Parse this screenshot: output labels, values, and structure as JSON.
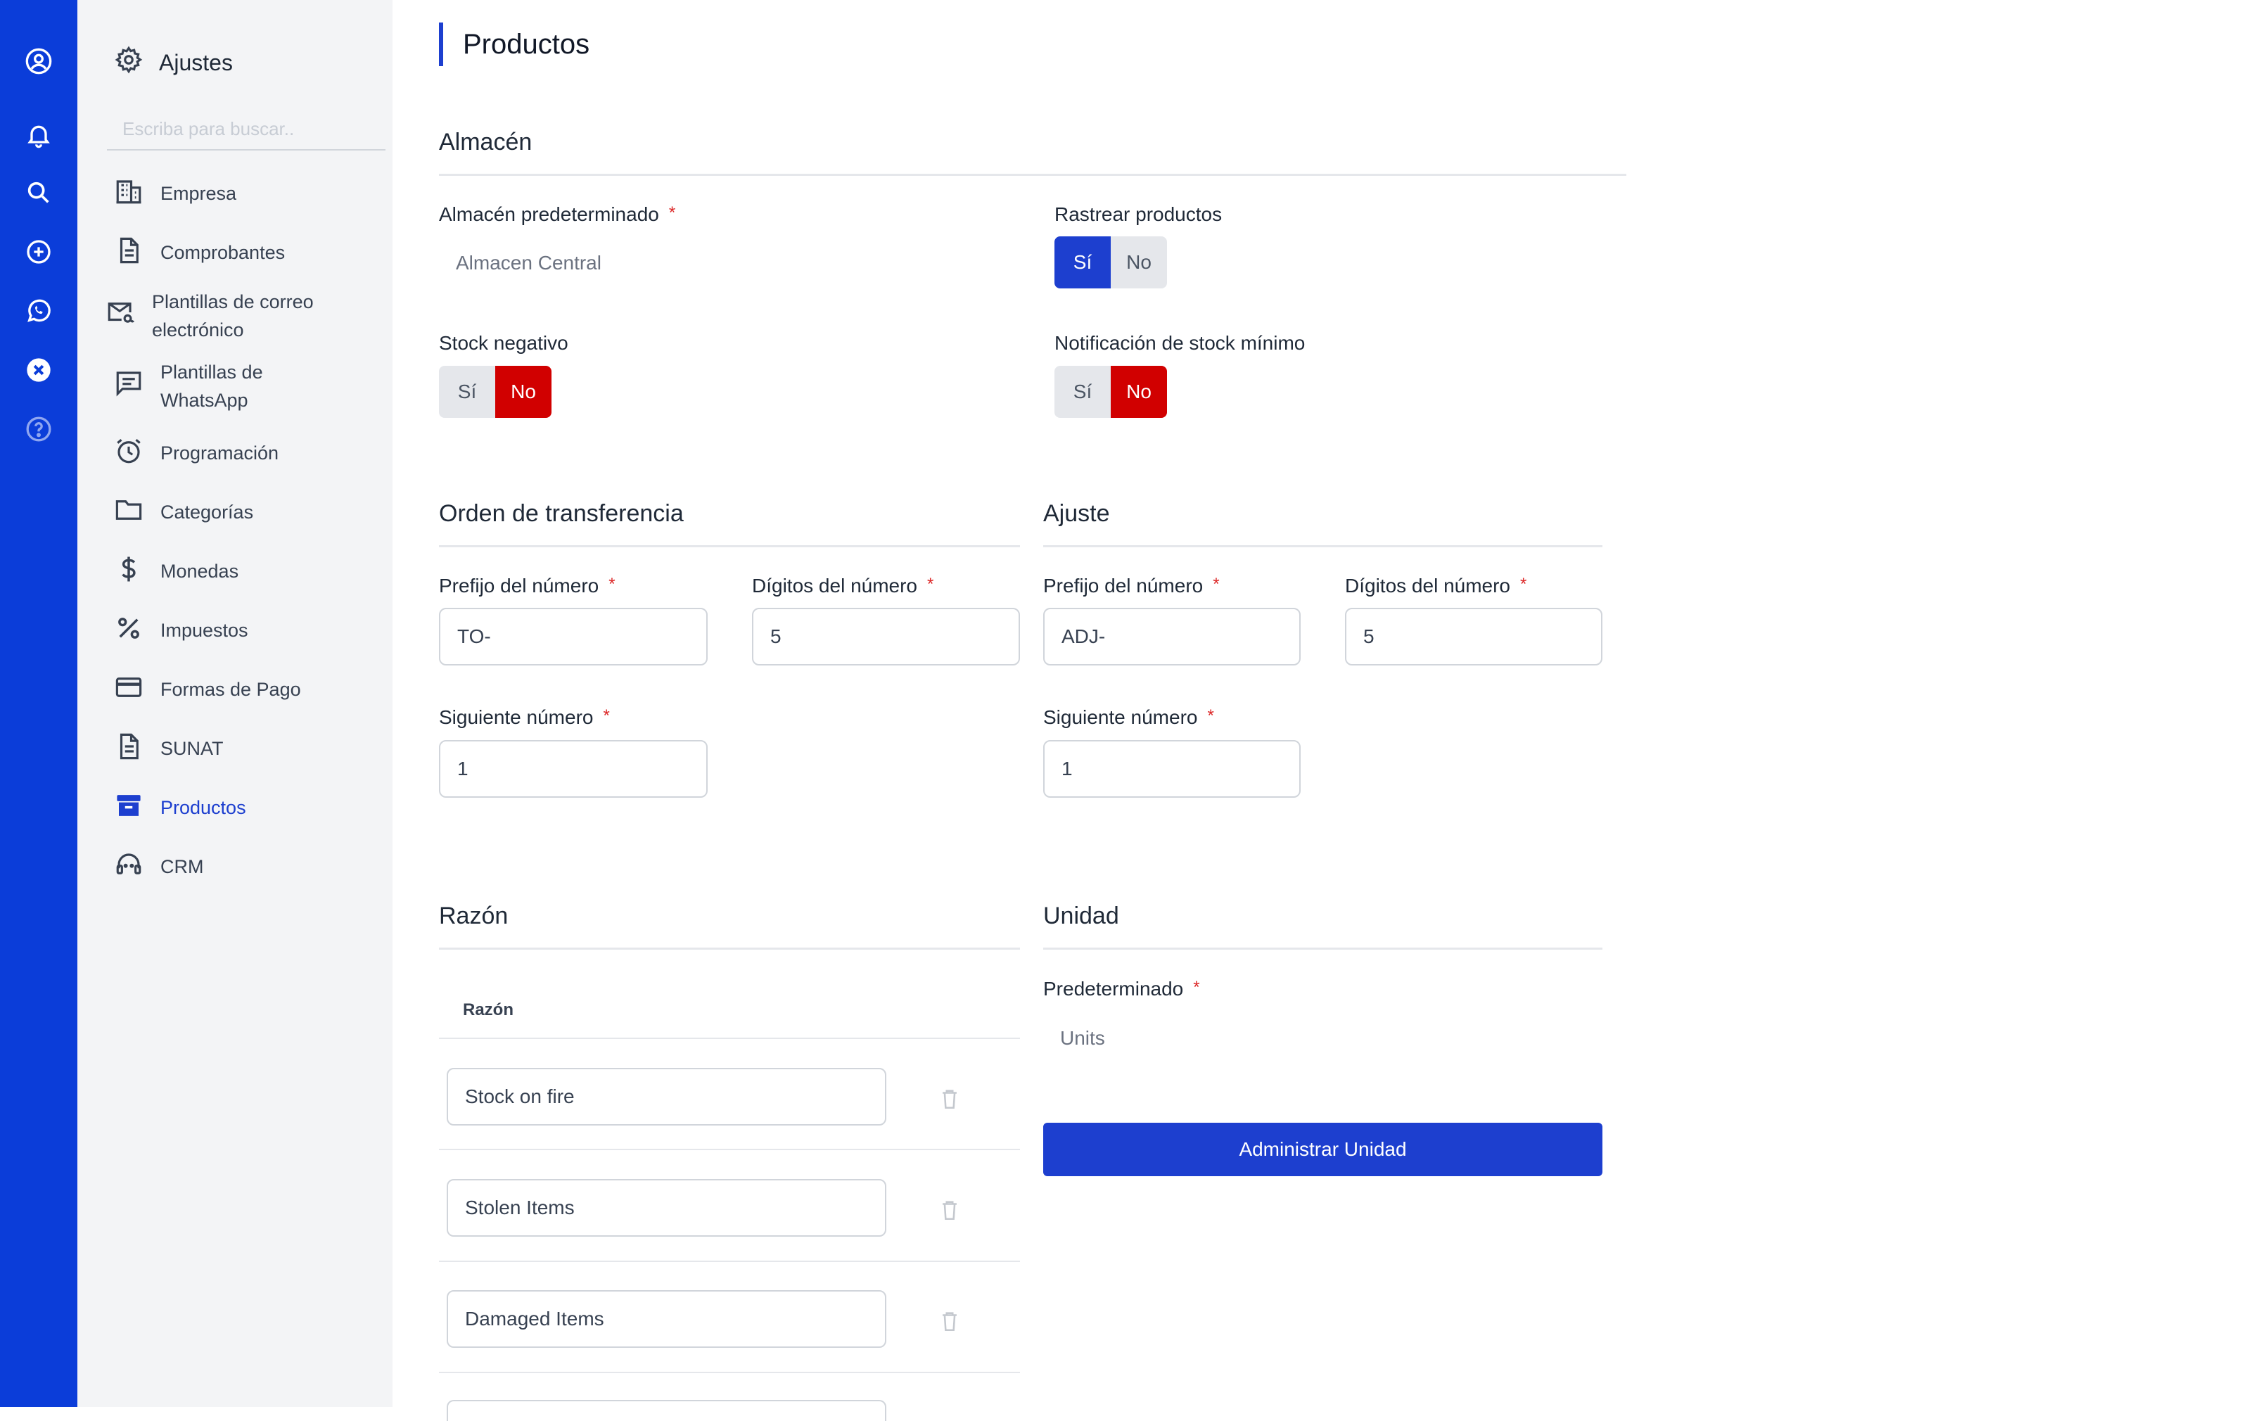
{
  "sidebar": {
    "title": "Ajustes",
    "search_placeholder": "Escriba para buscar..",
    "items": [
      {
        "label": "Empresa"
      },
      {
        "label": "Comprobantes"
      },
      {
        "label_line1": "Plantillas de correo",
        "label_line2": "electrónico"
      },
      {
        "label_line1": "Plantillas de",
        "label_line2": "WhatsApp"
      },
      {
        "label": "Programación"
      },
      {
        "label": "Categorías"
      },
      {
        "label": "Monedas"
      },
      {
        "label": "Impuestos"
      },
      {
        "label": "Formas de Pago"
      },
      {
        "label": "SUNAT"
      },
      {
        "label": "Productos",
        "active": true
      },
      {
        "label": "CRM"
      }
    ]
  },
  "page": {
    "title": "Productos"
  },
  "almacen": {
    "title": "Almacén",
    "default_label": "Almacén predeterminado",
    "default_value": "Almacen Central",
    "track_label": "Rastrear productos",
    "track": {
      "yes": "Sí",
      "no": "No",
      "selected": "Sí"
    },
    "negative_label": "Stock negativo",
    "negative": {
      "yes": "Sí",
      "no": "No",
      "selected": "No"
    },
    "min_label": "Notificación de stock mínimo",
    "min": {
      "yes": "Sí",
      "no": "No",
      "selected": "No"
    }
  },
  "transfer": {
    "title": "Orden de transferencia",
    "prefix_label": "Prefijo del número",
    "prefix_value": "TO-",
    "digits_label": "Dígitos del número",
    "digits_value": "5",
    "next_label": "Siguiente número",
    "next_value": "1"
  },
  "adjust": {
    "title": "Ajuste",
    "prefix_label": "Prefijo del número",
    "prefix_value": "ADJ-",
    "digits_label": "Dígitos del número",
    "digits_value": "5",
    "next_label": "Siguiente número",
    "next_value": "1"
  },
  "reason": {
    "title": "Razón",
    "column": "Razón",
    "rows": [
      "Stock on fire",
      "Stolen Items",
      "Damaged Items"
    ]
  },
  "unit": {
    "title": "Unidad",
    "default_label": "Predeterminado",
    "default_value": "Units",
    "manage_button": "Administrar Unidad"
  },
  "colors": {
    "rail": "#0b3dd9",
    "accent": "#1d3fcf",
    "danger": "#d10000",
    "sidebar_bg": "#f3f4f6"
  },
  "icons": [
    "user-circle-icon",
    "bell-icon",
    "search-icon",
    "plus-circle-icon",
    "whatsapp-icon",
    "close-circle-icon",
    "help-circle-icon",
    "gear-icon",
    "building-icon",
    "document-icon",
    "mail-icon",
    "chat-icon",
    "alarm-icon",
    "folder-icon",
    "dollar-icon",
    "percent-icon",
    "credit-card-icon",
    "archive-icon",
    "headset-icon",
    "trash-icon"
  ]
}
